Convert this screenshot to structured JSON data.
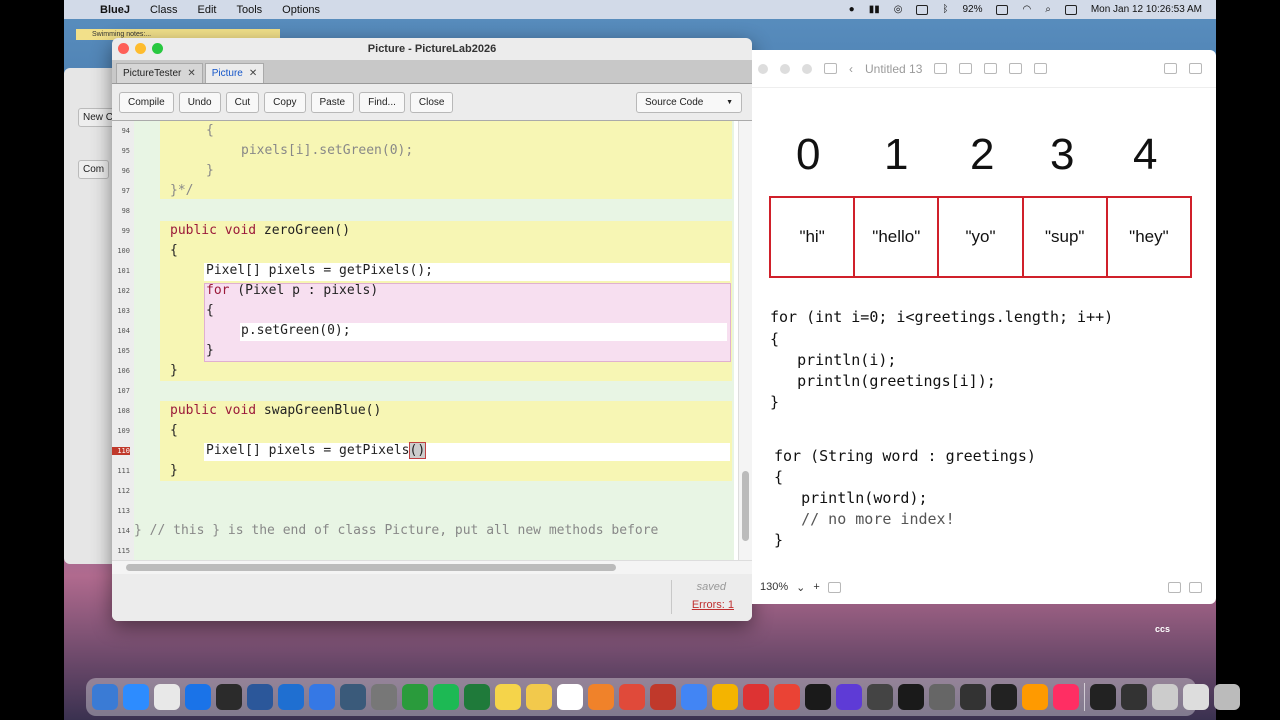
{
  "menubar": {
    "app_name": "BlueJ",
    "menus": [
      "Class",
      "Edit",
      "Tools",
      "Options"
    ],
    "battery": "92%",
    "datetime": "Mon Jan 12  10:26:53 AM"
  },
  "notification": "Swimming notes:...",
  "background_window": {
    "button1": "New C",
    "button2": "Com"
  },
  "editor": {
    "title": "Picture - PictureLab2026",
    "tabs": [
      {
        "label": "PictureTester",
        "active": false
      },
      {
        "label": "Picture",
        "active": true
      }
    ],
    "toolbar": {
      "compile": "Compile",
      "undo": "Undo",
      "cut": "Cut",
      "copy": "Copy",
      "paste": "Paste",
      "find": "Find...",
      "close": "Close",
      "view_select": "Source Code"
    },
    "lines": [
      {
        "n": "94",
        "text": "{"
      },
      {
        "n": "95",
        "text": "pixels[i].setGreen(0);"
      },
      {
        "n": "96",
        "text": "}"
      },
      {
        "n": "97",
        "text": "}*/"
      },
      {
        "n": "98",
        "text": ""
      },
      {
        "n": "99",
        "text": "public void zeroGreen()"
      },
      {
        "n": "100",
        "text": "{"
      },
      {
        "n": "101",
        "text": "Pixel[] pixels = getPixels();"
      },
      {
        "n": "102",
        "text": "for (Pixel p : pixels)"
      },
      {
        "n": "103",
        "text": "{"
      },
      {
        "n": "104",
        "text": "p.setGreen(0);"
      },
      {
        "n": "105",
        "text": "}"
      },
      {
        "n": "106",
        "text": "}"
      },
      {
        "n": "107",
        "text": ""
      },
      {
        "n": "108",
        "text": "public void swapGreenBlue()"
      },
      {
        "n": "109",
        "text": "{"
      },
      {
        "n": "110",
        "text": "Pixel[] pixels = getPixels",
        "cursor_text": "()",
        "error": true
      },
      {
        "n": "111",
        "text": "}"
      },
      {
        "n": "112",
        "text": ""
      },
      {
        "n": "113",
        "text": ""
      },
      {
        "n": "114",
        "text": "} // this } is the end of class Picture, put all new methods before"
      },
      {
        "n": "115",
        "text": ""
      }
    ],
    "status": {
      "saved": "saved",
      "errors": "Errors: 1"
    }
  },
  "doc": {
    "title": "Untitled 13",
    "indices": [
      "0",
      "1",
      "2",
      "3",
      "4"
    ],
    "cells": [
      "\"hi\"",
      "\"hello\"",
      "\"yo\"",
      "\"sup\"",
      "\"hey\""
    ],
    "code1": [
      "for (int i=0; i<greetings.length; i++)",
      "{",
      "   println(i);",
      "   println(greetings[i]);",
      "}"
    ],
    "code2": [
      "for (String word : greetings)",
      "{",
      "   println(word);",
      "   // no more index!",
      "}"
    ],
    "zoom": "130%"
  },
  "watermark": "ccs",
  "dock_colors": [
    "#3a7bd5",
    "#2d8cff",
    "#e8e8e8",
    "#1a73e8",
    "#2b2b2b",
    "#2b579a",
    "#1f6fd1",
    "#3578e5",
    "#3a5a7a",
    "#777",
    "#2a9b3c",
    "#1db954",
    "#1f7a3a",
    "#f5d44a",
    "#f2c94c",
    "#ffffff",
    "#f0822a",
    "#e04a3a",
    "#c0392b",
    "#4285f4",
    "#f4b400",
    "#d33",
    "#ea4335",
    "#1a1a1a",
    "#5e3bd6",
    "#444",
    "#1a1a1a",
    "#666",
    "#333",
    "#222",
    "#ff9a00",
    "#ff2e63",
    "#222",
    "#333",
    "#ccc",
    "#ddd",
    "#bbb"
  ]
}
